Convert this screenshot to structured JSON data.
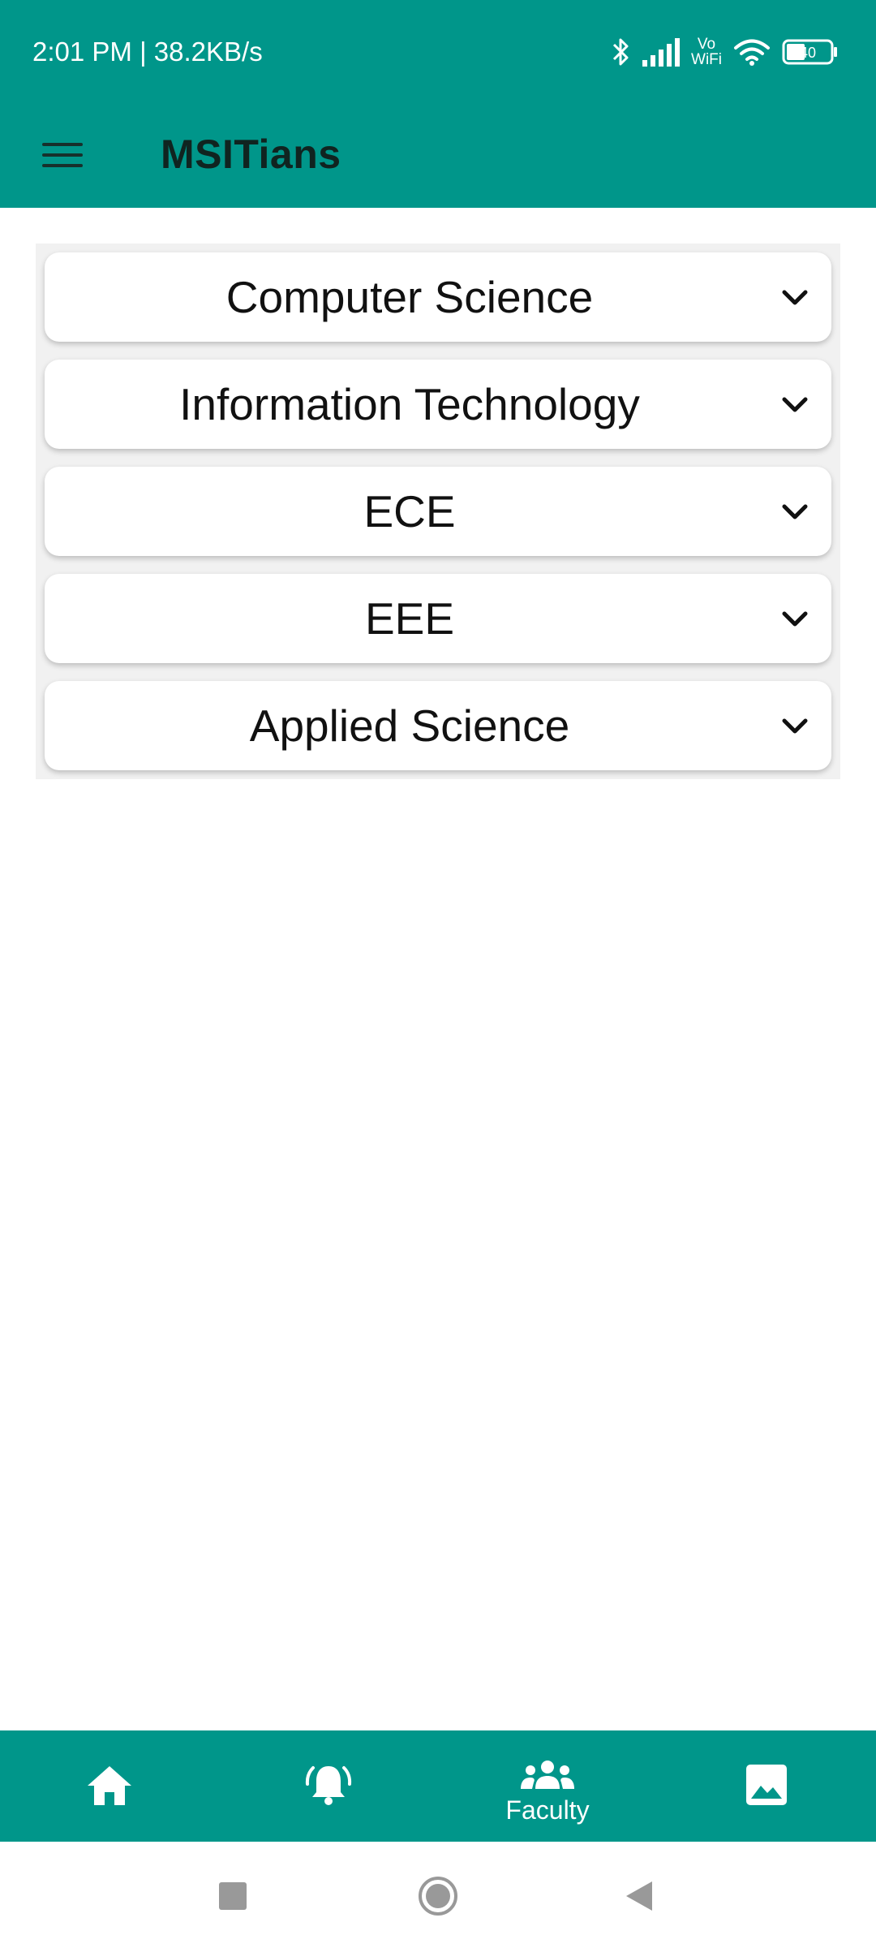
{
  "status_bar": {
    "time_speed": "2:01 PM | 38.2KB/s",
    "vowifi_top": "Vo",
    "vowifi_bottom": "WiFi",
    "battery": "40",
    "icons": [
      "bluetooth-icon",
      "signal-icon",
      "vowifi-icon",
      "wifi-icon",
      "battery-icon"
    ]
  },
  "app_bar": {
    "title": "MSITians",
    "menu_icon": "hamburger-menu-icon"
  },
  "departments": [
    {
      "label": "Computer Science"
    },
    {
      "label": "Information Technology"
    },
    {
      "label": "ECE"
    },
    {
      "label": "EEE"
    },
    {
      "label": "Applied Science"
    }
  ],
  "bottom_nav": {
    "items": [
      {
        "icon": "home-icon",
        "label": ""
      },
      {
        "icon": "notification-bell-icon",
        "label": ""
      },
      {
        "icon": "faculty-group-icon",
        "label": "Faculty"
      },
      {
        "icon": "gallery-image-icon",
        "label": ""
      }
    ],
    "selected": "Faculty"
  },
  "system_nav": {
    "icons": [
      "recents-square-icon",
      "home-circle-icon",
      "back-triangle-icon"
    ]
  },
  "colors": {
    "primary": "#00968a",
    "surface": "#ffffff",
    "list_background": "#f1f1f1",
    "title_text": "#102420"
  }
}
